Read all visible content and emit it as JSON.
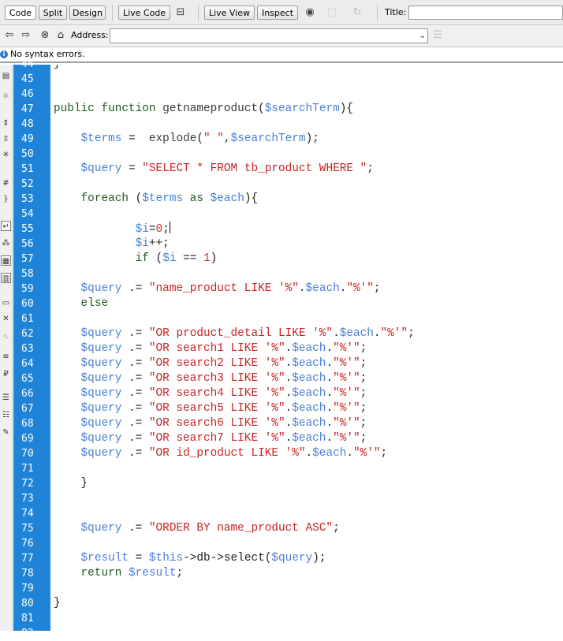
{
  "toolbar": {
    "view_buttons": [
      "Code",
      "Split",
      "Design"
    ],
    "live_code_label": "Live Code",
    "live_view_label": "Live View",
    "inspect_label": "Inspect",
    "title_label": "Title:",
    "title_value": ""
  },
  "address_bar": {
    "label": "Address:",
    "value": ""
  },
  "status": {
    "message": "No syntax errors."
  },
  "editor": {
    "line_numbers": [
      "44",
      "45",
      "46",
      "47",
      "48",
      "49",
      "50",
      "51",
      "52",
      "53",
      "54",
      "55",
      "56",
      "57",
      "58",
      "59",
      "60",
      "61",
      "62",
      "63",
      "64",
      "65",
      "66",
      "67",
      "68",
      "69",
      "70",
      "71",
      "72",
      "73",
      "74",
      "75",
      "76",
      "77",
      "78",
      "79",
      "80",
      "81",
      "82"
    ],
    "lines": [
      [
        [
          "punc",
          "}"
        ]
      ],
      [],
      [],
      [
        [
          "kw",
          "public function "
        ],
        [
          "fn",
          "getnameproduct"
        ],
        [
          "punc",
          "("
        ],
        [
          "var",
          "$searchTerm"
        ],
        [
          "punc",
          "){"
        ]
      ],
      [],
      [
        [
          "var",
          "    $terms"
        ],
        [
          "punc",
          " =  "
        ],
        [
          "fn",
          "explode"
        ],
        [
          "punc",
          "("
        ],
        [
          "str",
          "\" \""
        ],
        [
          "punc",
          ","
        ],
        [
          "var",
          "$searchTerm"
        ],
        [
          "punc",
          ");"
        ]
      ],
      [],
      [
        [
          "var",
          "    $query"
        ],
        [
          "punc",
          " = "
        ],
        [
          "str",
          "\"SELECT * FROM tb_product WHERE \""
        ],
        [
          "punc",
          ";"
        ]
      ],
      [],
      [
        [
          "kw",
          "    foreach "
        ],
        [
          "punc",
          "("
        ],
        [
          "var",
          "$terms"
        ],
        [
          "kw",
          " as "
        ],
        [
          "var",
          "$each"
        ],
        [
          "punc",
          "){"
        ]
      ],
      [],
      [
        [
          "var",
          "            $i"
        ],
        [
          "punc",
          "="
        ],
        [
          "num",
          "0"
        ],
        [
          "punc",
          ";"
        ],
        [
          "cursor",
          ""
        ]
      ],
      [
        [
          "var",
          "            $i"
        ],
        [
          "punc",
          "++;"
        ]
      ],
      [
        [
          "kw",
          "            if "
        ],
        [
          "punc",
          "("
        ],
        [
          "var",
          "$i"
        ],
        [
          "punc",
          " == "
        ],
        [
          "num",
          "1"
        ],
        [
          "punc",
          ")"
        ]
      ],
      [],
      [
        [
          "var",
          "    $query"
        ],
        [
          "punc",
          " .= "
        ],
        [
          "str",
          "\"name_product LIKE '%\""
        ],
        [
          "punc",
          "."
        ],
        [
          "var",
          "$each"
        ],
        [
          "punc",
          "."
        ],
        [
          "str",
          "\"%'\""
        ],
        [
          "punc",
          ";"
        ]
      ],
      [
        [
          "kw",
          "    else"
        ]
      ],
      [],
      [
        [
          "var",
          "    $query"
        ],
        [
          "punc",
          " .= "
        ],
        [
          "str",
          "\"OR product_detail LIKE '%\""
        ],
        [
          "punc",
          "."
        ],
        [
          "var",
          "$each"
        ],
        [
          "punc",
          "."
        ],
        [
          "str",
          "\"%'\""
        ],
        [
          "punc",
          ";"
        ]
      ],
      [
        [
          "var",
          "    $query"
        ],
        [
          "punc",
          " .= "
        ],
        [
          "str",
          "\"OR search1 LIKE '%\""
        ],
        [
          "punc",
          "."
        ],
        [
          "var",
          "$each"
        ],
        [
          "punc",
          "."
        ],
        [
          "str",
          "\"%'\""
        ],
        [
          "punc",
          ";"
        ]
      ],
      [
        [
          "var",
          "    $query"
        ],
        [
          "punc",
          " .= "
        ],
        [
          "str",
          "\"OR search2 LIKE '%\""
        ],
        [
          "punc",
          "."
        ],
        [
          "var",
          "$each"
        ],
        [
          "punc",
          "."
        ],
        [
          "str",
          "\"%'\""
        ],
        [
          "punc",
          ";"
        ]
      ],
      [
        [
          "var",
          "    $query"
        ],
        [
          "punc",
          " .= "
        ],
        [
          "str",
          "\"OR search3 LIKE '%\""
        ],
        [
          "punc",
          "."
        ],
        [
          "var",
          "$each"
        ],
        [
          "punc",
          "."
        ],
        [
          "str",
          "\"%'\""
        ],
        [
          "punc",
          ";"
        ]
      ],
      [
        [
          "var",
          "    $query"
        ],
        [
          "punc",
          " .= "
        ],
        [
          "str",
          "\"OR search4 LIKE '%\""
        ],
        [
          "punc",
          "."
        ],
        [
          "var",
          "$each"
        ],
        [
          "punc",
          "."
        ],
        [
          "str",
          "\"%'\""
        ],
        [
          "punc",
          ";"
        ]
      ],
      [
        [
          "var",
          "    $query"
        ],
        [
          "punc",
          " .= "
        ],
        [
          "str",
          "\"OR search5 LIKE '%\""
        ],
        [
          "punc",
          "."
        ],
        [
          "var",
          "$each"
        ],
        [
          "punc",
          "."
        ],
        [
          "str",
          "\"%'\""
        ],
        [
          "punc",
          ";"
        ]
      ],
      [
        [
          "var",
          "    $query"
        ],
        [
          "punc",
          " .= "
        ],
        [
          "str",
          "\"OR search6 LIKE '%\""
        ],
        [
          "punc",
          "."
        ],
        [
          "var",
          "$each"
        ],
        [
          "punc",
          "."
        ],
        [
          "str",
          "\"%'\""
        ],
        [
          "punc",
          ";"
        ]
      ],
      [
        [
          "var",
          "    $query"
        ],
        [
          "punc",
          " .= "
        ],
        [
          "str",
          "\"OR search7 LIKE '%\""
        ],
        [
          "punc",
          "."
        ],
        [
          "var",
          "$each"
        ],
        [
          "punc",
          "."
        ],
        [
          "str",
          "\"%'\""
        ],
        [
          "punc",
          ";"
        ]
      ],
      [
        [
          "var",
          "    $query"
        ],
        [
          "punc",
          " .= "
        ],
        [
          "str",
          "\"OR id_product LIKE '%\""
        ],
        [
          "punc",
          "."
        ],
        [
          "var",
          "$each"
        ],
        [
          "punc",
          "."
        ],
        [
          "str",
          "\"%'\""
        ],
        [
          "punc",
          ";"
        ]
      ],
      [],
      [
        [
          "punc",
          "    }"
        ]
      ],
      [],
      [],
      [
        [
          "var",
          "    $query"
        ],
        [
          "punc",
          " .= "
        ],
        [
          "str",
          "\"ORDER BY name_product ASC\""
        ],
        [
          "punc",
          ";"
        ]
      ],
      [],
      [
        [
          "var",
          "    $result"
        ],
        [
          "punc",
          " = "
        ],
        [
          "var",
          "$this"
        ],
        [
          "punc",
          "->db->select("
        ],
        [
          "var",
          "$query"
        ],
        [
          "punc",
          ");"
        ]
      ],
      [
        [
          "kw",
          "    return "
        ],
        [
          "var",
          "$result"
        ],
        [
          "punc",
          ";"
        ]
      ],
      [],
      [
        [
          "punc",
          "}"
        ]
      ],
      [],
      []
    ]
  },
  "icons": {
    "toolbar": [
      "layout-icon",
      "globe-icon",
      "inspect-icon",
      "refresh-icon"
    ],
    "nav": [
      "back-arrow-icon",
      "forward-arrow-icon",
      "stop-icon",
      "home-icon"
    ],
    "tools": [
      "open-document-icon",
      "collapse-icon",
      "expand-icon",
      "select-parent-icon",
      "balance-braces-icon",
      "line-numbers-icon",
      "highlight-invalid-icon",
      "word-wrap-icon",
      "syntax-icon",
      "apply-comment-icon",
      "remove-comment-icon",
      "wrap-tag-icon",
      "recent-snippets-icon",
      "move-css-icon",
      "indent-icon",
      "outdent-icon",
      "format-icon"
    ]
  },
  "colors": {
    "gutter": "#1f83d8",
    "keyword": "#215a21",
    "variable": "#4a7fd8",
    "string": "#c82323"
  }
}
